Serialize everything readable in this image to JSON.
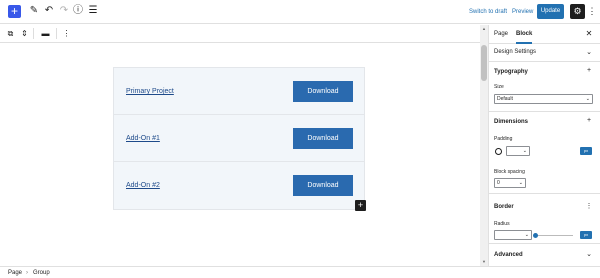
{
  "header": {
    "switch_to_draft": "Switch to draft",
    "preview": "Preview",
    "update": "Update",
    "icons": [
      "plus-icon",
      "pen-icon",
      "undo-icon",
      "redo-icon",
      "info-icon",
      "list-view-icon",
      "gear-icon",
      "more-vertical-icon"
    ]
  },
  "blocks": [
    {
      "link": "Primary Project",
      "button": "Download"
    },
    {
      "link": "Add-On #1",
      "button": "Download"
    },
    {
      "link": "Add-On #2",
      "button": "Download"
    }
  ],
  "sidebar": {
    "tabs": [
      "Page",
      "Block"
    ],
    "active_tab": "Block",
    "design_settings": "Design Settings",
    "typography": {
      "title": "Typography",
      "size_label": "Size",
      "size_value": "Default"
    },
    "dimensions": {
      "title": "Dimensions",
      "padding_label": "Padding",
      "padding_unit": "px",
      "block_spacing_label": "Block spacing",
      "block_spacing_value": "0"
    },
    "border": {
      "title": "Border",
      "radius_label": "Radius",
      "radius_unit": "px",
      "radius_level": 0
    },
    "advanced": "Advanced"
  },
  "footer": {
    "crumbs": [
      "Page",
      "Group"
    ]
  },
  "colors": {
    "accent": "#2271b1",
    "add_button": "#3858e9",
    "group_bg": "#f2f6fa",
    "download_button": "#2a6aaf"
  }
}
